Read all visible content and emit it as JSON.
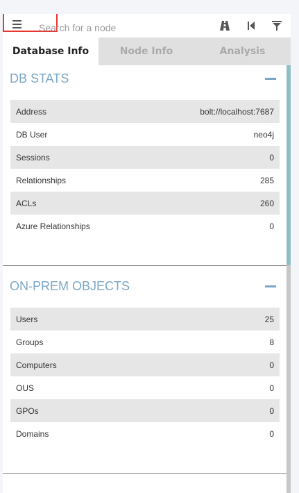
{
  "search": {
    "placeholder": "Search for a node"
  },
  "tabs": [
    {
      "label": "Database Info"
    },
    {
      "label": "Node Info"
    },
    {
      "label": "Analysis"
    }
  ],
  "db_stats": {
    "title": "DB STATS",
    "rows": [
      {
        "label": "Address",
        "value": "bolt://localhost:7687"
      },
      {
        "label": "DB User",
        "value": "neo4j"
      },
      {
        "label": "Sessions",
        "value": "0"
      },
      {
        "label": "Relationships",
        "value": "285"
      },
      {
        "label": "ACLs",
        "value": "260"
      },
      {
        "label": "Azure Relationships",
        "value": "0"
      }
    ]
  },
  "onprem": {
    "title": "ON-PREM OBJECTS",
    "rows": [
      {
        "label": "Users",
        "value": "25"
      },
      {
        "label": "Groups",
        "value": "8"
      },
      {
        "label": "Computers",
        "value": "0"
      },
      {
        "label": "OUS",
        "value": "0"
      },
      {
        "label": "GPOs",
        "value": "0"
      },
      {
        "label": "Domains",
        "value": "0"
      }
    ]
  },
  "icons": {
    "menu": "hamburger-menu-icon",
    "pathfinding": "pathfinding-icon",
    "back": "back-icon",
    "filter": "filter-icon"
  },
  "colors": {
    "accent": "#7aa7c7",
    "scroll_thumb": "#8fbfc5",
    "highlight_border": "#e8352e"
  }
}
